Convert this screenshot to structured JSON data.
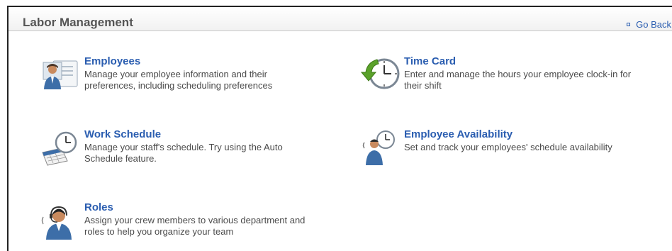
{
  "header": {
    "title": "Labor Management",
    "go_back_label": "Go Back"
  },
  "tiles": [
    {
      "title": "Employees",
      "description": "Manage your employee information and their preferences, including scheduling preferences",
      "icon": "employee-card-icon"
    },
    {
      "title": "Time Card",
      "description": "Enter and manage the hours your employee clock-in for their shift",
      "icon": "clock-arrow-icon"
    },
    {
      "title": "Work Schedule",
      "description": "Manage your staff's schedule. Try using the Auto Schedule feature.",
      "icon": "calendar-clock-icon"
    },
    {
      "title": "Employee Availability",
      "description": "Set and track your employees' schedule availability",
      "icon": "person-clock-icon"
    },
    {
      "title": "Roles",
      "description": "Assign your crew members to various department and roles to help you organize your team",
      "icon": "headset-person-icon"
    }
  ]
}
